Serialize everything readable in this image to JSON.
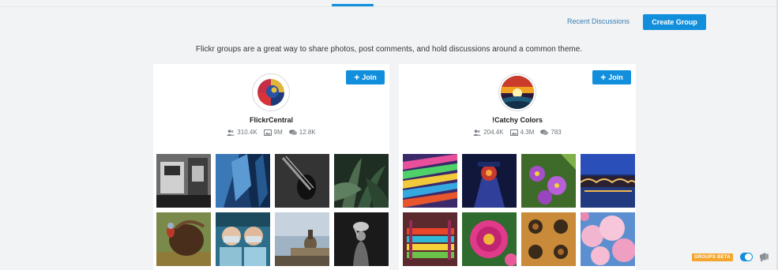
{
  "header": {
    "recent_discussions": "Recent Discussions",
    "create_group": "Create Group"
  },
  "tagline": "Flickr groups are a great way to share photos, post comments, and hold discussions around a common theme.",
  "groups": [
    {
      "name": "FlickrCentral",
      "join_label": "Join",
      "members": "310.4K",
      "photos": "9M",
      "discussions": "12.8K",
      "thumbnails": [
        "office-desk",
        "glass-skyscraper",
        "guitar",
        "plant-leaves",
        "turkey",
        "surgeons",
        "dome-building",
        "black-white-portrait"
      ]
    },
    {
      "name": "!Catchy Colors",
      "join_label": "Join",
      "members": "204.4K",
      "photos": "4.3M",
      "discussions": "783",
      "thumbnails": [
        "colorful-stripes",
        "blue-figure",
        "purple-flowers",
        "night-bridge",
        "colorful-bench",
        "pink-flower",
        "textured-circles",
        "cherry-blossoms"
      ]
    }
  ],
  "footer": {
    "beta_badge": "GROUPS BETA"
  },
  "colors": {
    "accent": "#128fdc",
    "beta": "#f4a52d"
  }
}
